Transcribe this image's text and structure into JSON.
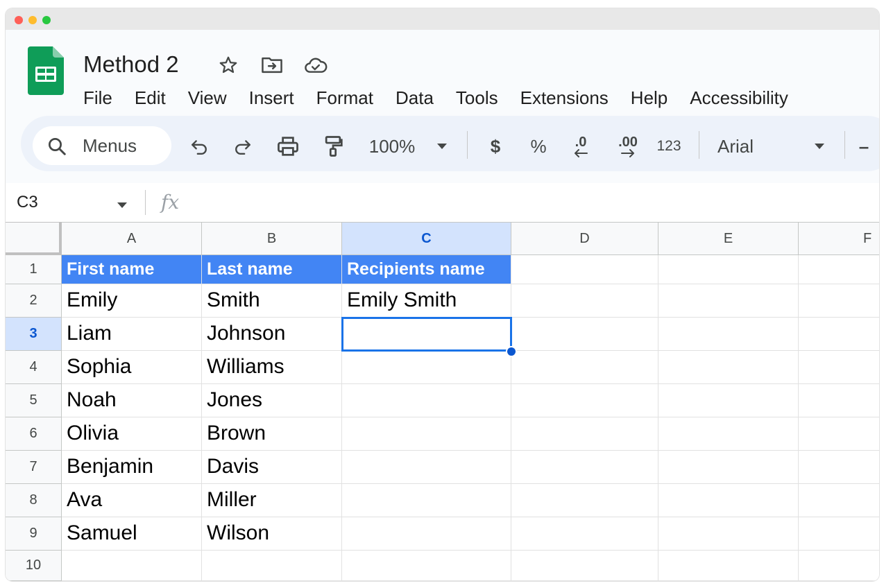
{
  "app": {
    "doc_title": "Method 2",
    "brand_color": "#0f9d58",
    "accent_color": "#1a73e8"
  },
  "title_icons": [
    "star-icon",
    "move-to-folder-icon",
    "cloud-saved-icon"
  ],
  "menubar": {
    "items": [
      "File",
      "Edit",
      "View",
      "Insert",
      "Format",
      "Data",
      "Tools",
      "Extensions",
      "Help",
      "Accessibility"
    ]
  },
  "toolbar": {
    "search_label": "Menus",
    "zoom": "100%",
    "currency": "$",
    "percent": "%",
    "decrease_decimal": ".0",
    "increase_decimal": ".00",
    "more_formats": "123",
    "font": "Arial",
    "font_size_minus": "–"
  },
  "formula_bar": {
    "cell_ref": "C3",
    "fx": "fx",
    "content": ""
  },
  "grid": {
    "columns": [
      "A",
      "B",
      "C",
      "D",
      "E",
      "F"
    ],
    "selected_column": "C",
    "rows": [
      "1",
      "2",
      "3",
      "4",
      "5",
      "6",
      "7",
      "8",
      "9",
      "10"
    ],
    "selected_row": "3",
    "header_row": [
      "First name",
      "Last name",
      "Recipients name"
    ],
    "data": [
      [
        "Emily",
        "Smith",
        "Emily Smith"
      ],
      [
        "Liam",
        "Johnson",
        ""
      ],
      [
        "Sophia",
        "Williams",
        ""
      ],
      [
        "Noah",
        "Jones",
        ""
      ],
      [
        "Olivia",
        "Brown",
        ""
      ],
      [
        "Benjamin",
        "Davis",
        ""
      ],
      [
        "Ava",
        "Miller",
        ""
      ],
      [
        "Samuel",
        "Wilson",
        ""
      ]
    ],
    "header_fill": "#4285f4"
  }
}
